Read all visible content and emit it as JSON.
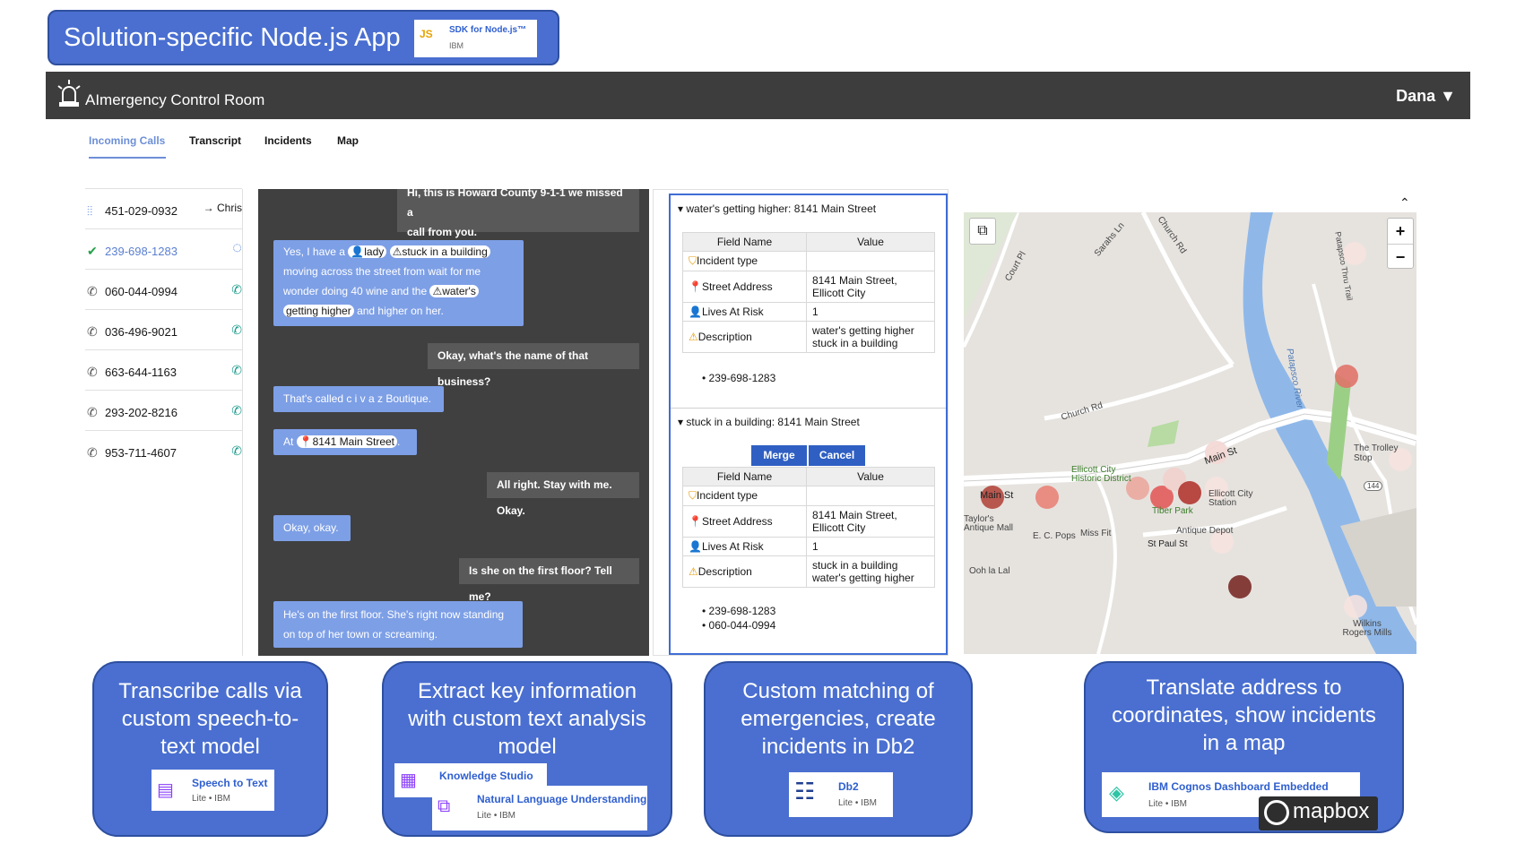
{
  "banner": {
    "title": "Solution-specific Node.js App",
    "sdk_name": "SDK for Node.js™",
    "sdk_vendor": "IBM",
    "sdk_icon": "JS"
  },
  "app": {
    "title": "AImergency Control Room",
    "user": "Dana ▼"
  },
  "tabs": [
    "Incoming Calls",
    "Transcript",
    "Incidents",
    "Map"
  ],
  "calls": [
    {
      "number": "451-029-0932",
      "action": "→ Chris",
      "icon": "voice-wave-icon"
    },
    {
      "number": "239-698-1283",
      "action": "◌",
      "icon": "check-circle-icon"
    },
    {
      "number": "060-044-0994",
      "action": "✆",
      "icon": "phone-icon"
    },
    {
      "number": "036-496-9021",
      "action": "✆",
      "icon": "phone-icon"
    },
    {
      "number": "663-644-1163",
      "action": "✆",
      "icon": "phone-icon"
    },
    {
      "number": "293-202-8216",
      "action": "✆",
      "icon": "phone-icon"
    },
    {
      "number": "953-711-4607",
      "action": "✆",
      "icon": "phone-icon"
    }
  ],
  "transcript": {
    "op1a": "Hi, this is Howard County 9-1-1 we missed a",
    "op1b": "call from you.",
    "c1": {
      "t1": "Yes, I have a ",
      "tag1": "👤lady",
      "tag2": "⚠stuck in a building",
      "t2": "moving across the street from wait for me",
      "t3": "wonder doing 40 wine and the ",
      "tag3": "⚠water's",
      "tag4": "getting higher",
      "t4": " and higher on her."
    },
    "op2": "Okay, what's the name of that business?",
    "c2": "That's called c i v a z Boutique.",
    "c3": {
      "t1": "At ",
      "tag1": "📍8141 Main Street",
      "t2": "."
    },
    "op3": "All right. Stay with me. Okay.",
    "c4": "Okay, okay.",
    "op4": "Is she on the first floor? Tell me?",
    "c5a": "He's on the first floor. She's right now standing",
    "c5b": "on top of her town or screaming."
  },
  "incidents": {
    "col_field": "Field Name",
    "col_value": "Value",
    "inc1": {
      "title": "▾ water's getting higher: 8141 Main Street",
      "rows": [
        {
          "icon": "⛉",
          "field": "Incident type",
          "value": ""
        },
        {
          "icon": "📍",
          "field": "Street Address",
          "value": "8141 Main Street,",
          "value2": "Ellicott City"
        },
        {
          "icon": "👤",
          "field": "Lives At Risk",
          "value": "1",
          "value2": ""
        },
        {
          "icon": "⚠",
          "field": "Description",
          "value": "water's getting higher",
          "value2": "stuck in a building"
        }
      ],
      "calls": [
        "239-698-1283"
      ]
    },
    "inc2": {
      "title": "▾ stuck in a building: 8141 Main Street",
      "merge": "Merge",
      "cancel": "Cancel",
      "rows": [
        {
          "icon": "⛉",
          "field": "Incident type",
          "value": ""
        },
        {
          "icon": "📍",
          "field": "Street Address",
          "value": "8141 Main Street,",
          "value2": "Ellicott City"
        },
        {
          "icon": "👤",
          "field": "Lives At Risk",
          "value": "1",
          "value2": ""
        },
        {
          "icon": "⚠",
          "field": "Description",
          "value": "stuck in a building",
          "value2": "water's getting higher"
        }
      ],
      "calls": [
        "239-698-1283",
        "060-044-0994"
      ]
    }
  },
  "map": {
    "zoom_in": "+",
    "zoom_out": "−",
    "collapse": "⌃",
    "labels": {
      "main_st": "Main St",
      "main_st2": "Main St",
      "church_rd": "Church Rd",
      "church_rd2": "Church Rd",
      "court_pl": "Court Pl",
      "sarahs_ln": "Sarahs Ln",
      "patapsco": "Patapsco River",
      "st_paul": "St Paul St",
      "tiber_park": "Tiber Park",
      "ellicott_hist": "Ellicott City Historic District",
      "ellicott_station": "Ellicott City Station",
      "taylors": "Taylor's Antique Mall",
      "ecpops": "E. C. Pops",
      "missfit": "Miss Fit",
      "antique_depot": "Antique Depot",
      "oohlalal": "Ooh la Lal",
      "trolley": "The Trolley Stop",
      "wilkins": "Wilkins Rogers Mills",
      "rt144": "144",
      "thru_trail": "Patapsco Thru Trail"
    }
  },
  "callouts": {
    "stt": {
      "text": "Transcribe calls via custom speech-to-text model",
      "svc": "Speech to Text",
      "vendor": "Lite • IBM"
    },
    "nlu": {
      "text": "Extract key information with custom text analysis model",
      "svc1": "Knowledge Studio",
      "svc2": "Natural Language Understanding",
      "vendor": "Lite • IBM"
    },
    "db2": {
      "text": "Custom matching of emergencies, create incidents in Db2",
      "svc": "Db2",
      "vendor": "Lite • IBM"
    },
    "map": {
      "text": "Translate address to coordinates, show incidents in a map",
      "svc": "IBM Cognos Dashboard Embedded",
      "vendor": "Lite • IBM",
      "mapbox": "mapbox"
    }
  }
}
